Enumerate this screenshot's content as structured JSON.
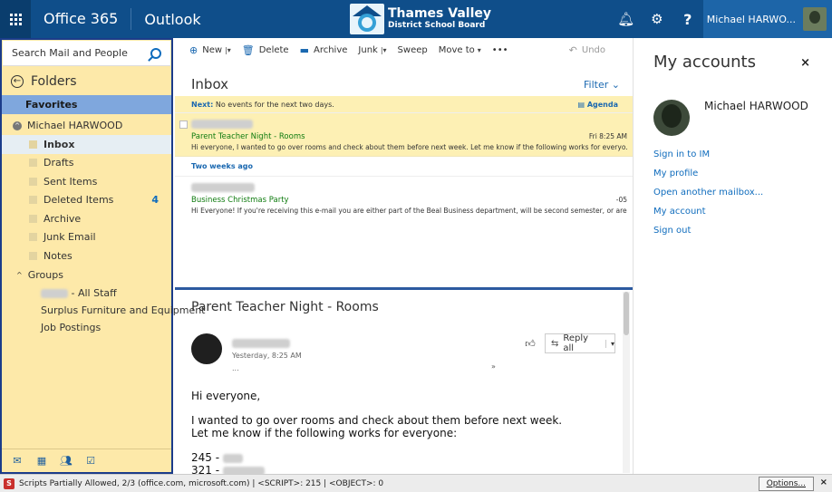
{
  "topbar": {
    "suite_label": "Office 365",
    "app_label": "Outlook",
    "brand": {
      "line1": "Thames Valley",
      "line2": "District School Board"
    },
    "icons": [
      "bell-icon",
      "gear-icon",
      "help-icon"
    ],
    "help_label": "?",
    "user_label": "Michael HARWO..."
  },
  "leftpane": {
    "search_placeholder": "Search Mail and People",
    "folders_label": "Folders",
    "favorites_label": "Favorites",
    "account_name": "Michael HARWOOD",
    "folders": [
      {
        "label": "Inbox",
        "count": "",
        "selected": true
      },
      {
        "label": "Drafts",
        "count": ""
      },
      {
        "label": "Sent Items",
        "count": ""
      },
      {
        "label": "Deleted Items",
        "count": "4"
      },
      {
        "label": "Archive",
        "count": ""
      },
      {
        "label": "Junk Email",
        "count": ""
      },
      {
        "label": "Notes",
        "count": ""
      }
    ],
    "groups_label": "Groups",
    "groups": [
      "- All Staff",
      "Surplus Furniture and Equipment",
      "Job Postings"
    ]
  },
  "toolbar": {
    "new_label": "New",
    "delete_label": "Delete",
    "archive_label": "Archive",
    "junk_label": "Junk",
    "sweep_label": "Sweep",
    "moveto_label": "Move to",
    "more_label": "•••",
    "undo_label": "Undo"
  },
  "list": {
    "title": "Inbox",
    "filter_label": "Filter",
    "next_label": "Next:",
    "next_text": "No events for the next two days.",
    "agenda_label": "Agenda",
    "messages": [
      {
        "subject": "Parent Teacher Night - Rooms",
        "time": "Fri 8:25 AM",
        "preview": "Hi everyone, I wanted to go over rooms and check about them before next week. Let me know if the following works for everyo..."
      },
      {
        "subject": "Business Christmas Party",
        "time": "-05",
        "preview": "Hi Everyone! If you're receiving this e-mail you are either part of the Beal Business department, will be second semester, or are a..."
      }
    ],
    "section_label": "Two weeks ago"
  },
  "reading": {
    "title": "Parent Teacher Night - Rooms",
    "time": "Yesterday, 8:25 AM",
    "dots": "...",
    "reply_label": "Reply all",
    "body": [
      "Hi everyone,",
      "I wanted to go over rooms and check about them before next week.",
      "Let me know if the following works for everyone:",
      "245 -",
      "321 -"
    ]
  },
  "accounts": {
    "title": "My accounts",
    "close": "×",
    "name": "Michael HARWOOD",
    "links": [
      "Sign in to IM",
      "My profile",
      "Open another mailbox...",
      "My account",
      "Sign out"
    ]
  },
  "statusbar": {
    "text": "Scripts Partially Allowed, 2/3 (office.com, microsoft.com) | <SCRIPT>: 215 | <OBJECT>: 0",
    "options_label": "Options...",
    "close": "×"
  },
  "colors": {
    "topbar": "#0f4e8a",
    "folder_pane": "#fde9a9",
    "favorites": "#7fa7dd",
    "link": "#0f6cbd",
    "subject": "#107c10"
  }
}
